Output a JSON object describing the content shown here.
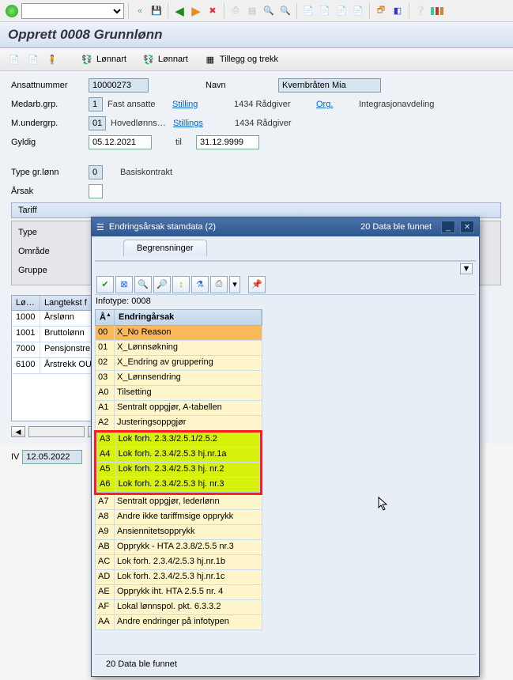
{
  "page": {
    "title": "Opprett 0008 Grunnlønn"
  },
  "actions": {
    "lonnart1": "Lønnart",
    "lonnart2": "Lønnart",
    "tillegg": "Tillegg og trekk"
  },
  "form": {
    "ansatt_lbl": "Ansattnummer",
    "ansatt_val": "10000273",
    "navn_lbl": "Navn",
    "navn_val": "Kvernbråten Mia",
    "medarb_lbl": "Medarb.grp.",
    "medarb_val": "1",
    "medarb_txt": "Fast ansatte",
    "stilling_lbl": "Stilling",
    "stilling_txt": "1434 Rådgiver",
    "org_lbl": "Org.",
    "org_txt": "Integrasjonavdeling",
    "munder_lbl": "M.undergrp.",
    "munder_val": "01",
    "munder_txt": "Hovedlønns…",
    "stillings_lbl": "Stillings",
    "stillings_txt": "1434 Rådgiver",
    "gyldig_lbl": "Gyldig",
    "gyldig_fra": "05.12.2021",
    "til_lbl": "til",
    "gyldig_til": "31.12.9999",
    "typegr_lbl": "Type gr.lønn",
    "typegr_val": "0",
    "typegr_txt": "Basiskontrakt",
    "aarsak_lbl": "Årsak",
    "tariff_hdr": "Tariff",
    "type_lbl": "Type",
    "omraade_lbl": "Område",
    "gruppe_lbl": "Gruppe"
  },
  "grid": {
    "cols": {
      "c1": "Lø…",
      "c2": "Langtekst f"
    },
    "rows": [
      {
        "a": "1000",
        "b": "Årslønn"
      },
      {
        "a": "1001",
        "b": "Bruttolønn"
      },
      {
        "a": "7000",
        "b": "Pensjonstre"
      },
      {
        "a": "6100",
        "b": "Årstrekk OU"
      }
    ]
  },
  "bottom": {
    "iv_lbl": "IV",
    "iv_date": "12.05.2022"
  },
  "popup": {
    "title": "Endringsårsak stamdata (2)",
    "count": "20 Data ble funnet",
    "tab": "Begrensninger",
    "infotype": "Infotype: 0008",
    "col_a": "Å",
    "col_b": "Endringårsak",
    "rows": [
      {
        "a": "00",
        "b": "X_No Reason",
        "s": true
      },
      {
        "a": "01",
        "b": "X_Lønnsøkning"
      },
      {
        "a": "02",
        "b": "X_Endring av gruppering"
      },
      {
        "a": "03",
        "b": "X_Lønnsendring"
      },
      {
        "a": "A0",
        "b": "Tilsetting"
      },
      {
        "a": "A1",
        "b": "Sentralt oppgjør, A-tabellen"
      },
      {
        "a": "A2",
        "b": "Justeringsoppgjør"
      },
      {
        "a": "A3",
        "b": "Lok forh. 2.3.3/2.5.1/2.5.2",
        "hl": true
      },
      {
        "a": "A4",
        "b": "Lok forh. 2.3.4/2.5.3 hj.nr.1a",
        "hl": true
      },
      {
        "a": "A5",
        "b": "Lok forh. 2.3.4/2.5.3 hj. nr.2",
        "hl": true
      },
      {
        "a": "A6",
        "b": "Lok forh. 2.3.4/2.5.3 hj. nr.3",
        "hl": true
      },
      {
        "a": "A7",
        "b": "Sentralt oppgjør, lederlønn"
      },
      {
        "a": "A8",
        "b": "Andre ikke tariffmsige opprykk"
      },
      {
        "a": "A9",
        "b": "Ansiennitetsopprykk"
      },
      {
        "a": "AB",
        "b": "Opprykk - HTA 2.3.8/2.5.5 nr.3"
      },
      {
        "a": "AC",
        "b": "Lok forh. 2.3.4/2.5.3 hj.nr.1b"
      },
      {
        "a": "AD",
        "b": "Lok forh. 2.3.4/2.5.3 hj.nr.1c"
      },
      {
        "a": "AE",
        "b": "Opprykk iht. HTA 2.5.5 nr. 4"
      },
      {
        "a": "AF",
        "b": "Lokal lønnspol. pkt. 6.3.3.2"
      },
      {
        "a": "AA",
        "b": "Andre endringer på infotypen"
      }
    ],
    "status": "20 Data ble funnet"
  }
}
